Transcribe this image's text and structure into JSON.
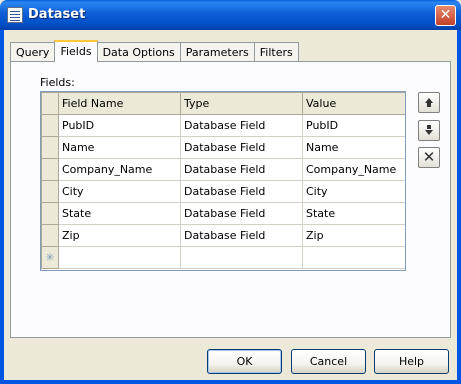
{
  "window": {
    "title": "Dataset",
    "close_glyph": "✕"
  },
  "tabs": [
    {
      "label": "Query",
      "active": false
    },
    {
      "label": "Fields",
      "active": true
    },
    {
      "label": "Data Options",
      "active": false
    },
    {
      "label": "Parameters",
      "active": false
    },
    {
      "label": "Filters",
      "active": false
    }
  ],
  "fields_panel": {
    "label": "Fields:",
    "columns": [
      "Field Name",
      "Type",
      "Value"
    ],
    "rows": [
      {
        "field_name": "PubID",
        "type": "Database Field",
        "value": "PubID"
      },
      {
        "field_name": "Name",
        "type": "Database Field",
        "value": "Name"
      },
      {
        "field_name": "Company_Name",
        "type": "Database Field",
        "value": "Company_Name"
      },
      {
        "field_name": "City",
        "type": "Database Field",
        "value": "City"
      },
      {
        "field_name": "State",
        "type": "Database Field",
        "value": "State"
      },
      {
        "field_name": "Zip",
        "type": "Database Field",
        "value": "Zip"
      }
    ],
    "new_row_marker": "✳"
  },
  "side_buttons": {
    "move_up_icon": "arrow-up-icon",
    "move_down_icon": "arrow-down-icon",
    "delete_icon": "delete-x-icon",
    "delete_glyph": "✕"
  },
  "buttons": {
    "ok": "OK",
    "cancel": "Cancel",
    "help": "Help"
  }
}
